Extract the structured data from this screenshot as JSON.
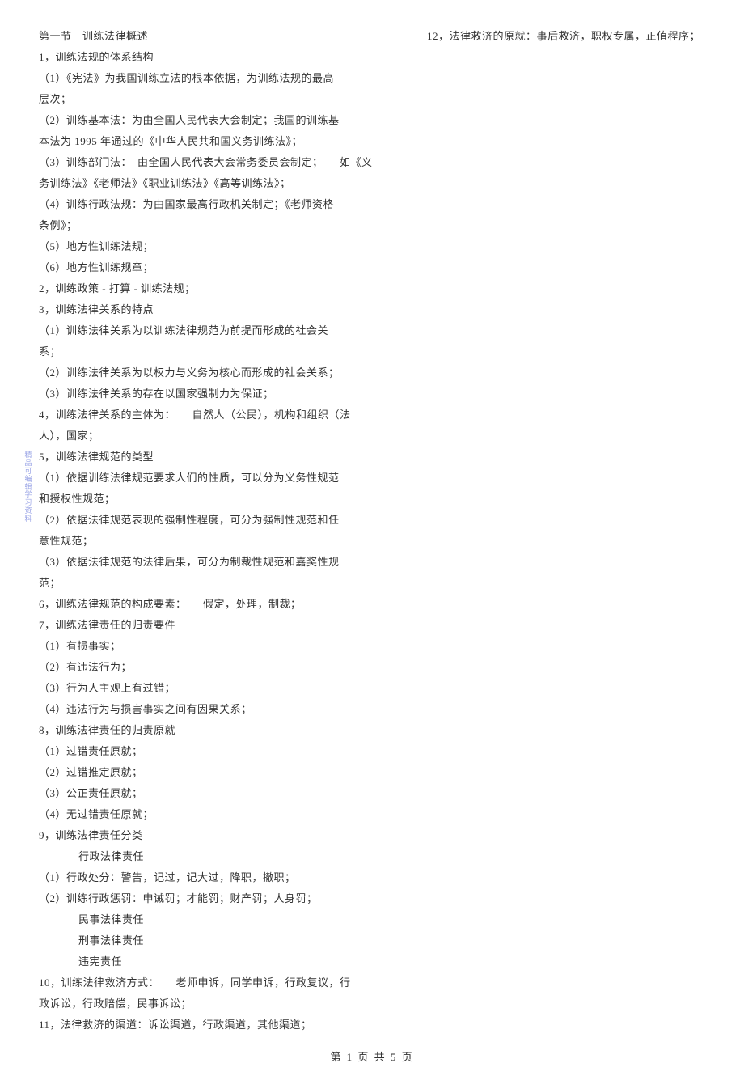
{
  "sideStrip": [
    "精",
    "品",
    "可",
    "编",
    "辑",
    "学",
    "习",
    "资",
    "料"
  ],
  "leftColumn": [
    "第一节　训练法律概述",
    "1，训练法规的体系结构",
    "（1）《宪法》为我国训练立法的根本依据，为训练法规的最高",
    "层次；",
    "（2）训练基本法：为由全国人民代表大会制定；我国的训练基",
    "本法为 1995 年通过的《中华人民共和国义务训练法》；",
    "（3）训练部门法：　由全国人民代表大会常务委员会制定；　　如《义",
    "务训练法》《老师法》《职业训练法》《高等训练法》；",
    "（4）训练行政法规：为由国家最高行政机关制定；《老师资格",
    "条例》；",
    "（5）地方性训练法规；",
    "（6）地方性训练规章；",
    "2，训练政策 - 打算 - 训练法规；",
    "3，训练法律关系的特点",
    "（1）训练法律关系为以训练法律规范为前提而形成的社会关",
    "系；",
    "（2）训练法律关系为以权力与义务为核心而形成的社会关系；",
    "（3）训练法律关系的存在以国家强制力为保证；",
    "4，训练法律关系的主体为：　　自然人（公民），机构和组织（法",
    "人），国家；",
    "5，训练法律规范的类型",
    "（1）依据训练法律规范要求人们的性质，可以分为义务性规范",
    "和授权性规范；",
    "（2）依据法律规范表现的强制性程度，可分为强制性规范和任",
    "意性规范；",
    "（3）依据法律规范的法律后果，可分为制裁性规范和嘉奖性规",
    "范；",
    "6，训练法律规范的构成要素：　　假定，处理，制裁；",
    "7，训练法律责任的归责要件",
    "（1）有损事实；",
    "（2）有违法行为；",
    "（3）行为人主观上有过错；",
    "（4）违法行为与损害事实之间有因果关系；",
    "8，训练法律责任的归责原就",
    "（1）过错责任原就；",
    "（2）过错推定原就；",
    "（3）公正责任原就；",
    "（4）无过错责任原就；",
    "9，训练法律责任分类",
    "　　行政法律责任",
    "（1）行政处分：警告，记过，记大过，降职，撤职；",
    "（2）训练行政惩罚：申诫罚；才能罚；财产罚；人身罚；",
    "　　民事法律责任",
    "　　刑事法律责任",
    "　　违宪责任",
    "10，训练法律救济方式：　　老师申诉，同学申诉，行政复议，行",
    "政诉讼，行政赔偿，民事诉讼；",
    "11，法律救济的渠道：诉讼渠道，行政渠道，其他渠道；"
  ],
  "rightColumn": [
    "12，法律救济的原就：事后救济，职权专属，正值程序；"
  ],
  "footer": "第 1 页 共 5 页"
}
